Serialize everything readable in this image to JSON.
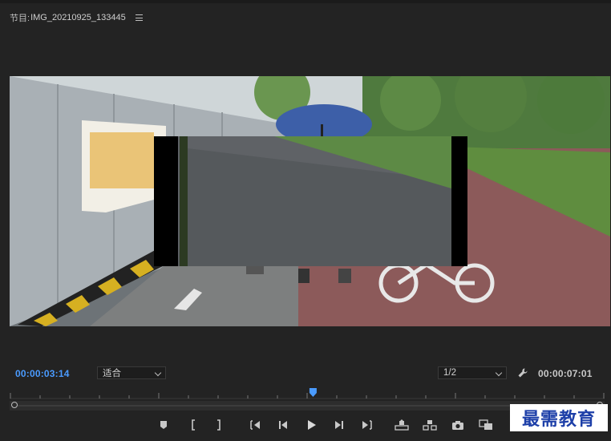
{
  "panel": {
    "label": "节目:",
    "sequence_name": "IMG_20210925_133445",
    "menu_icon": "hamburger-icon"
  },
  "playback": {
    "current_timecode": "00:00:03:14",
    "duration_timecode": "00:00:07:01",
    "zoom_fit": "适合",
    "resolution": "1/2",
    "playhead_fraction": 0.51
  },
  "transport_icons": [
    "add-marker-icon",
    "mark-in-icon",
    "mark-out-icon",
    "go-to-in-icon",
    "step-back-icon",
    "play-icon",
    "step-forward-icon",
    "go-to-out-icon",
    "lift-icon",
    "extract-icon",
    "export-frame-icon",
    "comparison-view-icon"
  ],
  "colors": {
    "accent_blue": "#4a9bff",
    "panel_bg": "#232323"
  },
  "watermark": {
    "text": "最需教育"
  }
}
